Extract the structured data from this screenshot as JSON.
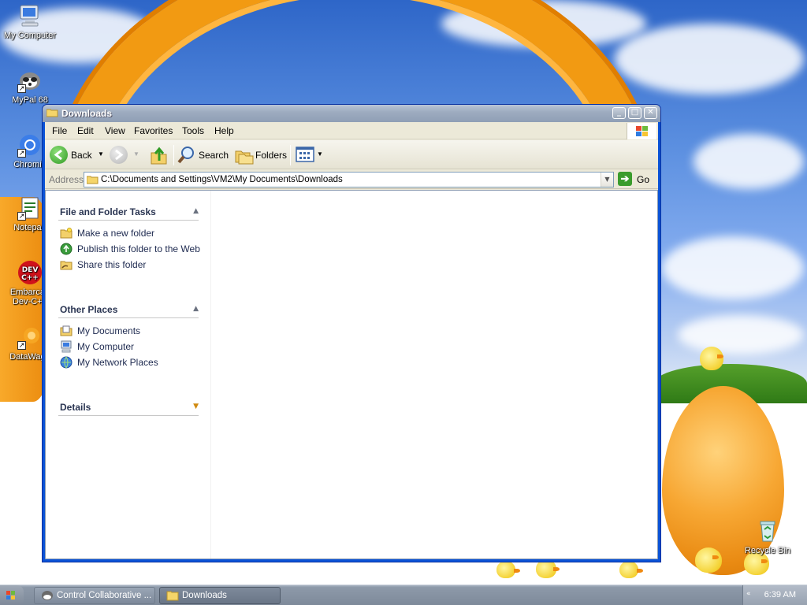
{
  "desktop": {
    "icons": [
      {
        "label": "My Computer",
        "icon": "my-computer-icon"
      },
      {
        "label": "MyPal 68",
        "icon": "mypal-icon"
      },
      {
        "label": "Chromiu",
        "icon": "chromium-icon"
      },
      {
        "label": "Notepad",
        "icon": "notepad-icon"
      },
      {
        "label": "Embarcad Dev-C++",
        "icon": "devcpp-icon"
      },
      {
        "label": "DataWago",
        "icon": "datawagon-icon"
      },
      {
        "label": "Recycle Bin",
        "icon": "recycle-bin-icon"
      }
    ]
  },
  "window": {
    "title": "Downloads",
    "menu": [
      "File",
      "Edit",
      "View",
      "Favorites",
      "Tools",
      "Help"
    ],
    "toolbar": {
      "back": "Back",
      "search": "Search",
      "folders": "Folders"
    },
    "address": {
      "label": "Address",
      "value": "C:\\Documents and Settings\\VM2\\My Documents\\Downloads",
      "go": "Go"
    },
    "taskpane": {
      "file_tasks": {
        "title": "File and Folder Tasks",
        "items": [
          "Make a new folder",
          "Publish this folder to the Web",
          "Share this folder"
        ]
      },
      "other_places": {
        "title": "Other Places",
        "items": [
          "My Documents",
          "My Computer",
          "My Network Places"
        ]
      },
      "details": {
        "title": "Details"
      }
    }
  },
  "taskbar": {
    "tasks": [
      "Control Collaborative ...",
      "Downloads"
    ],
    "clock": "6:39 AM"
  },
  "colors": {
    "accent": "#0a52d6",
    "go_green": "#3a9c2c",
    "taskpane_heading": "#2a3552"
  }
}
